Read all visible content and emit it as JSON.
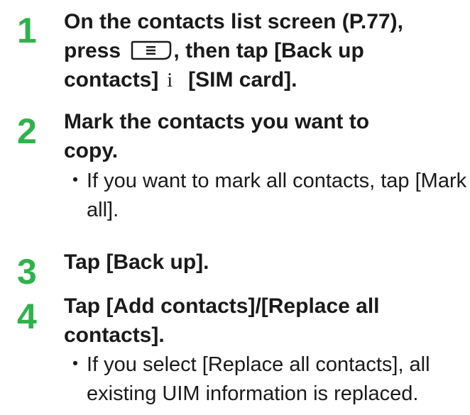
{
  "steps": [
    {
      "number": "1",
      "title_part1": "On the contacts list screen (P.77),",
      "title_part2_pre": "press",
      "title_part2_post": ", then tap [Back up",
      "title_part3_pre": "contacts]",
      "title_part3_arrow": "i",
      "title_part3_post": "[SIM card]."
    },
    {
      "number": "2",
      "title": "Mark the contacts you want to copy.",
      "note_bullet": "・",
      "note": "If you want to mark all contacts, tap [Mark all]."
    },
    {
      "number": "3",
      "title": "Tap [Back up]."
    },
    {
      "number": "4",
      "title": "Tap [Add contacts]/[Replace all contacts].",
      "note_bullet": "・",
      "note": "If you select [Replace all contacts], all existing UIM information is replaced."
    }
  ],
  "icons": {
    "menu_key": "menu-key-icon"
  },
  "colors": {
    "step_number": "#2fb24c",
    "text": "#1a1a1a"
  }
}
